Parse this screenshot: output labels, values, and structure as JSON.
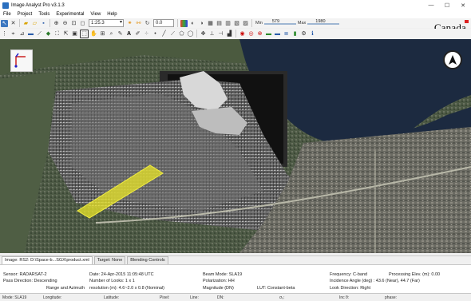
{
  "window": {
    "title": "Image Analyst Pro v3.1.3",
    "controls": [
      "—",
      "☐",
      "✕"
    ]
  },
  "menu": [
    "File",
    "Project",
    "Tools",
    "Experimental",
    "View",
    "Help"
  ],
  "toolbar": {
    "zoom_value": "1:25.3",
    "rotation_value": "0.0",
    "min_label": "Min",
    "min_value": "579",
    "max_label": "Max",
    "max_value": "1980",
    "brand": "Canada"
  },
  "tabs": [
    {
      "label": "Image: RS2: D:\\Space-b...SGX\\product.xml",
      "active": true
    },
    {
      "label": "Target: None",
      "active": false
    },
    {
      "label": "Blending Controls",
      "active": false
    }
  ],
  "info": {
    "sensor": "Sensor: RADARSAT-2",
    "pass_direction": "Pass Direction: Descending",
    "range_azimuth": "Range and Azimuth",
    "date": "Date: 24-Apr-2015 11:05:48 UTC",
    "looks": "Number of Looks: 1 x 1",
    "resolution": "resolution (m): 4.6~2.0 x 0.8 (Nominal)",
    "beam_mode": "Beam Mode: SLA19",
    "polarization": "Polarization: HH",
    "magnitude": "Magnitude (DN)",
    "lut": "LUT: Constant-beta",
    "frequency": "Frequency: C-band",
    "processing_elev": "Processing Elev. (m): 0.00",
    "incidence": "Incidence Angle (deg) : 43.6 (Near), 44.7 (Far)",
    "look_direction": "Look Direction: Right"
  },
  "status": {
    "mode": "Mode: SLA19",
    "longitude": "Longitude:",
    "latitude": "Latitude:",
    "pixel": "Pixel:",
    "line": "Line:",
    "dn": "DN:",
    "sigma": "σ₀:",
    "incidence": "Inc θ:",
    "phase": "phase:"
  },
  "icons": {
    "compass": "north-arrow-icon",
    "north_button": "compass-north-icon"
  }
}
